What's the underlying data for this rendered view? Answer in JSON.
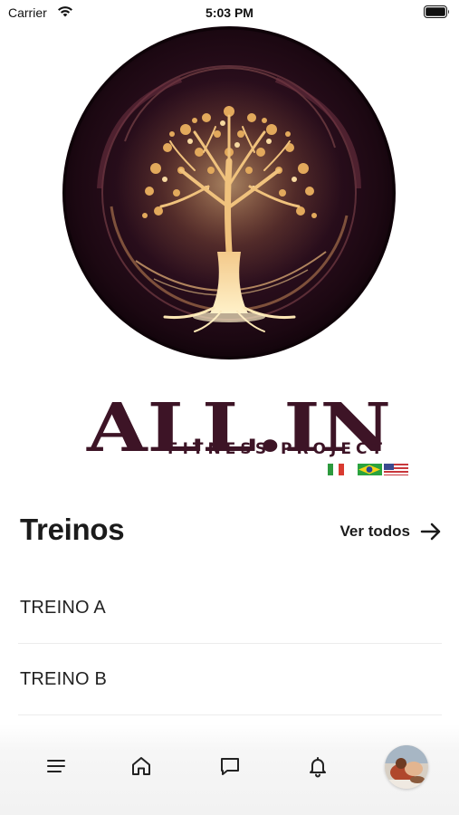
{
  "status_bar": {
    "carrier": "Carrier",
    "time": "5:03 PM"
  },
  "logo": {
    "brand": "ALL.IN",
    "subtitle": "FITNESS PROJECT",
    "brand_color": "#3d1426",
    "flags": [
      "italy-flag",
      "brazil-flag",
      "usa-flag"
    ]
  },
  "workouts": {
    "title": "Treinos",
    "see_all_label": "Ver todos",
    "items": [
      {
        "label": "TREINO A"
      },
      {
        "label": "TREINO B"
      }
    ]
  },
  "bottom_nav": {
    "items": [
      "menu-icon",
      "home-icon",
      "chat-icon",
      "bell-icon",
      "avatar"
    ]
  }
}
